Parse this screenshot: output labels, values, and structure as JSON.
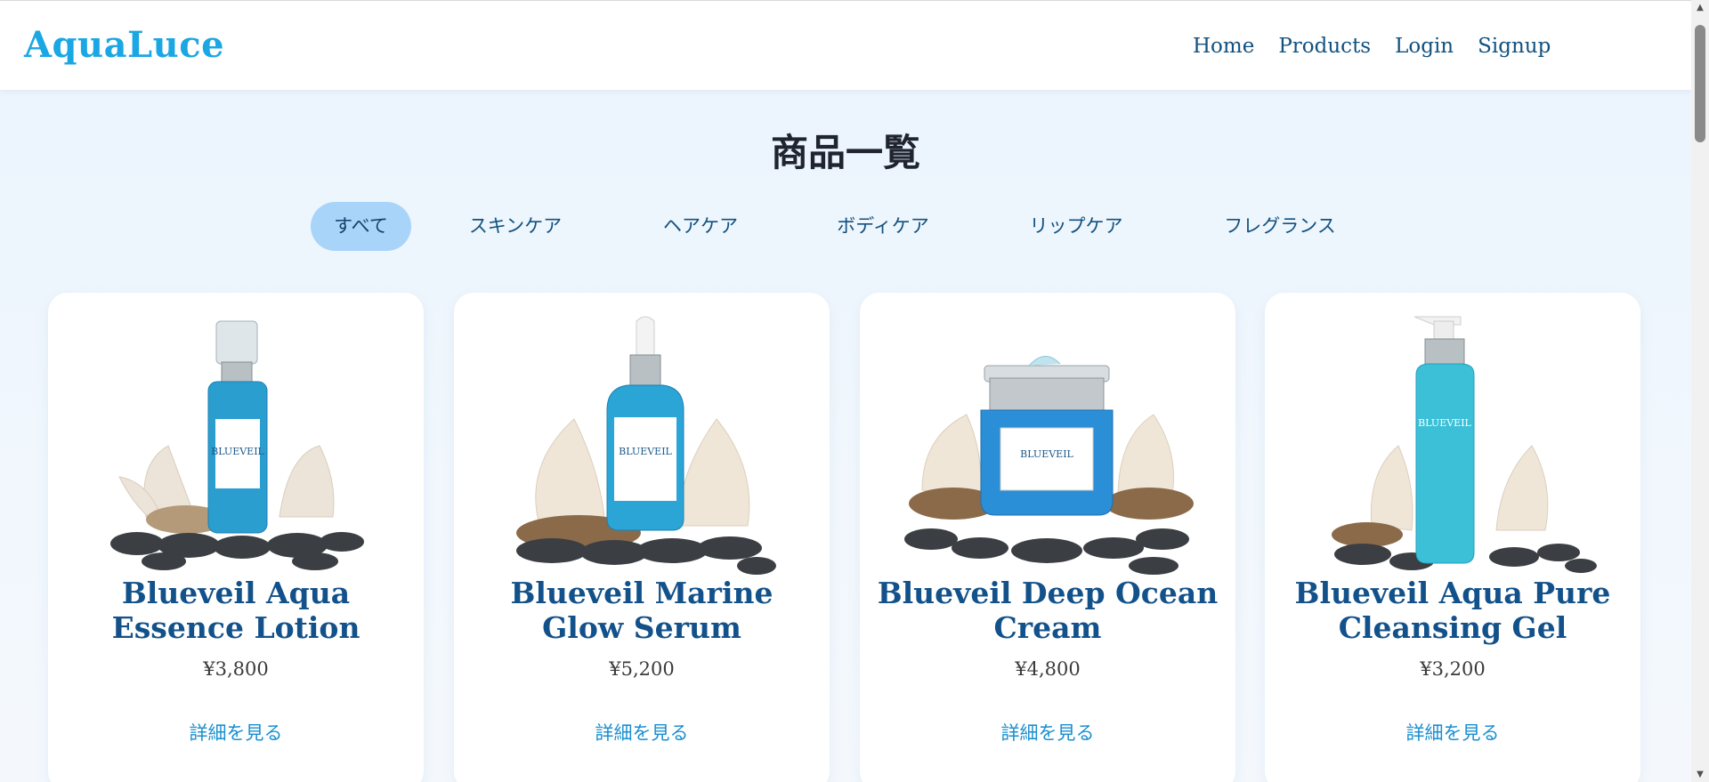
{
  "header": {
    "logo": "AquaLuce",
    "nav": [
      {
        "label": "Home"
      },
      {
        "label": "Products"
      },
      {
        "label": "Login"
      },
      {
        "label": "Signup"
      }
    ]
  },
  "main": {
    "title": "商品一覧",
    "categories": [
      {
        "label": "すべて",
        "active": true
      },
      {
        "label": "スキンケア",
        "active": false
      },
      {
        "label": "ヘアケア",
        "active": false
      },
      {
        "label": "ボディケア",
        "active": false
      },
      {
        "label": "リップケア",
        "active": false
      },
      {
        "label": "フレグランス",
        "active": false
      }
    ],
    "products": [
      {
        "name": "Blueveil Aqua Essence Lotion",
        "price": "¥3,800",
        "detail_label": "詳細を見る",
        "image_icon": "lotion-bottle-image",
        "brand_label": "BLUEVEIL"
      },
      {
        "name": "Blueveil Marine Glow Serum",
        "price": "¥5,200",
        "detail_label": "詳細を見る",
        "image_icon": "serum-dropper-image",
        "brand_label": "BLUEVEIL"
      },
      {
        "name": "Blueveil Deep Ocean Cream",
        "price": "¥4,800",
        "detail_label": "詳細を見る",
        "image_icon": "cream-jar-image",
        "brand_label": "BLUEVEIL"
      },
      {
        "name": "Blueveil Aqua Pure Cleansing Gel",
        "price": "¥3,200",
        "detail_label": "詳細を見る",
        "image_icon": "cleansing-gel-pump-image",
        "brand_label": "BLUEVEIL"
      }
    ]
  },
  "colors": {
    "brand": "#1aa7e3",
    "nav_text": "#12517f",
    "product_name": "#12518a",
    "detail_link": "#1a8fd0",
    "active_tab_bg": "#a9d4fa",
    "page_bg": "#eef6fd"
  }
}
